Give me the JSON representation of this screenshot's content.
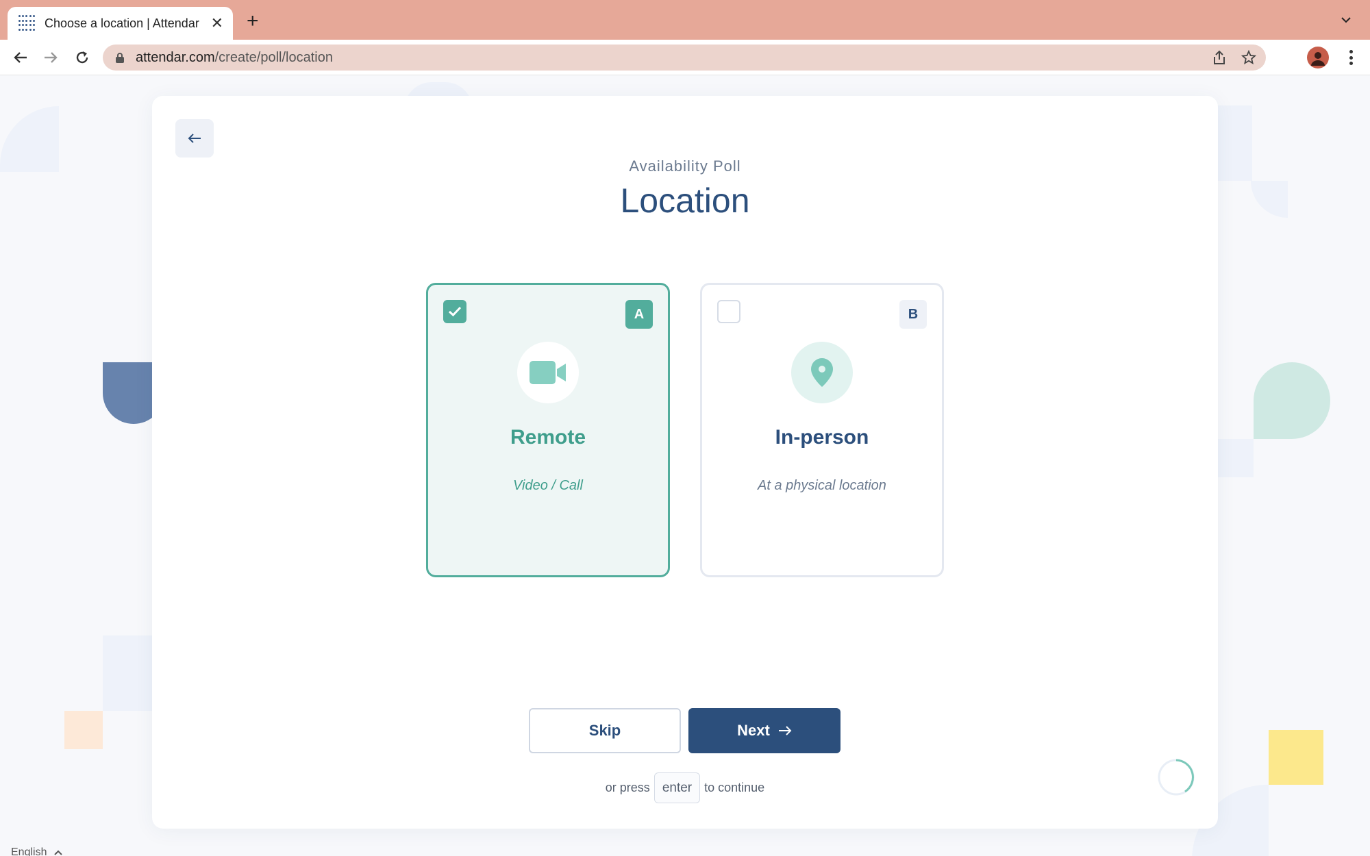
{
  "browser": {
    "tab_title": "Choose a location | Attendar",
    "url_domain": "attendar.com",
    "url_path": "/create/poll/location"
  },
  "poll": {
    "subtitle": "Availability Poll",
    "title": "Location"
  },
  "options": [
    {
      "key": "A",
      "title": "Remote",
      "description": "Video / Call",
      "selected": true,
      "icon": "video-camera-icon"
    },
    {
      "key": "B",
      "title": "In-person",
      "description": "At a physical location",
      "selected": false,
      "icon": "map-pin-icon"
    }
  ],
  "actions": {
    "skip_label": "Skip",
    "next_label": "Next"
  },
  "hint": {
    "prefix": "or press",
    "key": "enter",
    "suffix": "to continue"
  },
  "footer": {
    "language": "English"
  },
  "colors": {
    "primary": "#2c4f7c",
    "accent": "#52ad9c",
    "tab_bar": "#e6a898"
  }
}
